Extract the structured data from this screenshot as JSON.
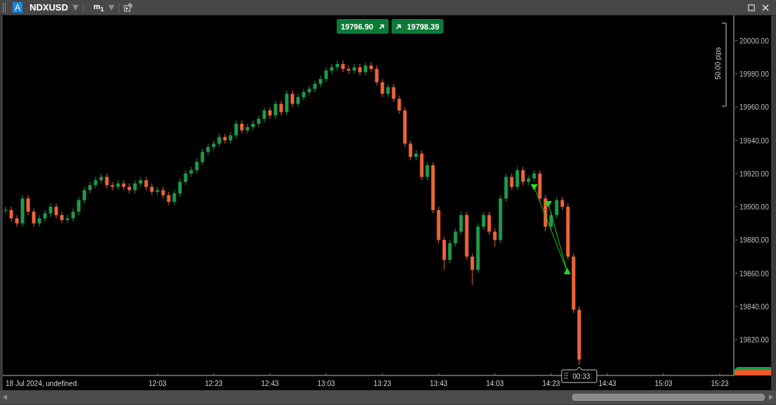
{
  "header": {
    "account_badge": "A",
    "symbol": "NDXUSD",
    "timeframe": "m$_{1}$"
  },
  "quotes": [
    {
      "kind": "sell",
      "price": "19796.90"
    },
    {
      "kind": "buy",
      "price": "19798.39"
    }
  ],
  "chart": {
    "date_label": "18 Jul 2024, undefined",
    "scale_label": "50.00 pips",
    "countdown": "00:33",
    "chart_data": {
      "type": "candlestick",
      "ylim": [
        19798.4,
        20015.2
      ],
      "yticks": [
        {
          "value": 20000,
          "label": "20000.00"
        },
        {
          "value": 19980,
          "label": "19980.00"
        },
        {
          "value": 19960,
          "label": "19960.00"
        },
        {
          "value": 19940,
          "label": "19940.00"
        },
        {
          "value": 19920,
          "label": "19920.00"
        },
        {
          "value": 19900,
          "label": "19900.00"
        },
        {
          "value": 19880,
          "label": "19880.00"
        },
        {
          "value": 19860,
          "label": "19860.00"
        },
        {
          "value": 19840,
          "label": "19840.00"
        },
        {
          "value": 19820,
          "label": "19820.00"
        }
      ],
      "categories": [
        null,
        null,
        null,
        null,
        null,
        null,
        null,
        null,
        null,
        null,
        null,
        null,
        null,
        null,
        null,
        null,
        null,
        null,
        null,
        null,
        null,
        null,
        null,
        null,
        null,
        null,
        null,
        "12:03",
        null,
        null,
        null,
        null,
        null,
        null,
        null,
        null,
        null,
        "12:23",
        null,
        null,
        null,
        null,
        null,
        null,
        null,
        null,
        null,
        "12:43",
        null,
        null,
        null,
        null,
        null,
        null,
        null,
        null,
        null,
        "13:03",
        null,
        null,
        null,
        null,
        null,
        null,
        null,
        null,
        null,
        "13:23",
        null,
        null,
        null,
        null,
        null,
        null,
        null,
        null,
        null,
        "13:43",
        null,
        null,
        null,
        null,
        null,
        null,
        null,
        null,
        null,
        "14:03",
        null,
        null,
        null,
        null,
        null,
        null,
        null,
        null,
        null,
        "14:23",
        null,
        null,
        null,
        null,
        null,
        null,
        null,
        null,
        null,
        "14:43",
        null,
        null,
        null,
        null,
        null,
        null,
        null,
        null,
        null,
        "15:03",
        null,
        null,
        null,
        null,
        null,
        null,
        null,
        null,
        null,
        "15:23",
        null,
        null
      ],
      "ohlc": [
        [
          19898,
          19900,
          19896,
          19898
        ],
        [
          19898,
          19900,
          19891,
          19893
        ],
        [
          19893,
          19895,
          19888,
          19890
        ],
        [
          19890,
          19907,
          19888,
          19905
        ],
        [
          19905,
          19907,
          19895,
          19897
        ],
        [
          19897,
          19899,
          19888,
          19890
        ],
        [
          19890,
          19895,
          19888,
          19893
        ],
        [
          19893,
          19898,
          19891,
          19896
        ],
        [
          19896,
          19902,
          19894,
          19900
        ],
        [
          19900,
          19902,
          19893,
          19895
        ],
        [
          19895,
          19897,
          19890,
          19892
        ],
        [
          19892,
          19895,
          19890,
          19893
        ],
        [
          19893,
          19899,
          19891,
          19897
        ],
        [
          19897,
          19906,
          19895,
          19904
        ],
        [
          19904,
          19912,
          19902,
          19910
        ],
        [
          19910,
          19915,
          19908,
          19913
        ],
        [
          19913,
          19918,
          19911,
          19916
        ],
        [
          19916,
          19920,
          19914,
          19918
        ],
        [
          19918,
          19920,
          19911,
          19913
        ],
        [
          19913,
          19915,
          19910,
          19912
        ],
        [
          19912,
          19916,
          19910,
          19914
        ],
        [
          19914,
          19916,
          19910,
          19912
        ],
        [
          19912,
          19914,
          19908,
          19910
        ],
        [
          19910,
          19916,
          19908,
          19914
        ],
        [
          19914,
          19918,
          19912,
          19916
        ],
        [
          19916,
          19918,
          19910,
          19912
        ],
        [
          19912,
          19914,
          19907,
          19909
        ],
        [
          19909,
          19912,
          19907,
          19910
        ],
        [
          19910,
          19912,
          19905,
          19907
        ],
        [
          19907,
          19909,
          19901,
          19903
        ],
        [
          19903,
          19910,
          19901,
          19908
        ],
        [
          19908,
          19917,
          19906,
          19915
        ],
        [
          19915,
          19922,
          19913,
          19920
        ],
        [
          19920,
          19924,
          19918,
          19922
        ],
        [
          19922,
          19929,
          19920,
          19927
        ],
        [
          19927,
          19935,
          19925,
          19933
        ],
        [
          19933,
          19938,
          19931,
          19936
        ],
        [
          19936,
          19940,
          19934,
          19938
        ],
        [
          19938,
          19944,
          19936,
          19942
        ],
        [
          19942,
          19944,
          19938,
          19940
        ],
        [
          19940,
          19945,
          19938,
          19943
        ],
        [
          19943,
          19952,
          19941,
          19950
        ],
        [
          19950,
          19952,
          19944,
          19946
        ],
        [
          19946,
          19950,
          19944,
          19948
        ],
        [
          19948,
          19952,
          19946,
          19950
        ],
        [
          19950,
          19955,
          19948,
          19953
        ],
        [
          19953,
          19960,
          19951,
          19958
        ],
        [
          19958,
          19960,
          19953,
          19955
        ],
        [
          19955,
          19964,
          19953,
          19962
        ],
        [
          19962,
          19964,
          19955,
          19957
        ],
        [
          19957,
          19970,
          19955,
          19968
        ],
        [
          19968,
          19970,
          19960,
          19962
        ],
        [
          19962,
          19968,
          19960,
          19966
        ],
        [
          19966,
          19971,
          19964,
          19969
        ],
        [
          19969,
          19973,
          19967,
          19971
        ],
        [
          19971,
          19976,
          19969,
          19974
        ],
        [
          19974,
          19979,
          19972,
          19977
        ],
        [
          19977,
          19984,
          19975,
          19982
        ],
        [
          19982,
          19986,
          19980,
          19984
        ],
        [
          19984,
          19988,
          19982,
          19986
        ],
        [
          19986,
          19988,
          19981,
          19983
        ],
        [
          19983,
          19985,
          19980,
          19982
        ],
        [
          19982,
          19986,
          19980,
          19984
        ],
        [
          19984,
          19986,
          19979,
          19981
        ],
        [
          19981,
          19987,
          19979,
          19985
        ],
        [
          19985,
          19987,
          19981,
          19983
        ],
        [
          19983,
          19985,
          19973,
          19975
        ],
        [
          19975,
          19977,
          19966,
          19968
        ],
        [
          19968,
          19974,
          19966,
          19972
        ],
        [
          19972,
          19974,
          19963,
          19965
        ],
        [
          19965,
          19967,
          19956,
          19958
        ],
        [
          19958,
          19960,
          19936,
          19938
        ],
        [
          19938,
          19940,
          19928,
          19930
        ],
        [
          19930,
          19934,
          19928,
          19932
        ],
        [
          19932,
          19934,
          19916,
          19918
        ],
        [
          19918,
          19927,
          19916,
          19925
        ],
        [
          19925,
          19927,
          19896,
          19898
        ],
        [
          19898,
          19900,
          19878,
          19880
        ],
        [
          19880,
          19882,
          19862,
          19868
        ],
        [
          19868,
          19880,
          19866,
          19878
        ],
        [
          19878,
          19887,
          19876,
          19885
        ],
        [
          19885,
          19897,
          19883,
          19895
        ],
        [
          19895,
          19897,
          19868,
          19870
        ],
        [
          19870,
          19872,
          19853,
          19862
        ],
        [
          19862,
          19890,
          19860,
          19888
        ],
        [
          19888,
          19897,
          19886,
          19895
        ],
        [
          19895,
          19897,
          19883,
          19885
        ],
        [
          19885,
          19887,
          19876,
          19880
        ],
        [
          19880,
          19907,
          19878,
          19905
        ],
        [
          19905,
          19920,
          19903,
          19918
        ],
        [
          19918,
          19920,
          19910,
          19912
        ],
        [
          19912,
          19924,
          19910,
          19922
        ],
        [
          19922,
          19924,
          19913,
          19915
        ],
        [
          19915,
          19919,
          19913,
          19917
        ],
        [
          19917,
          19922,
          19915,
          19920
        ],
        [
          19920,
          19922,
          19903,
          19905
        ],
        [
          19905,
          19907,
          19885,
          19888
        ],
        [
          19888,
          19897,
          19886,
          19895
        ],
        [
          19895,
          19906,
          19893,
          19904
        ],
        [
          19904,
          19906,
          19898,
          19900
        ],
        [
          19900,
          19902,
          19868,
          19870
        ],
        [
          19870,
          19872,
          19836,
          19838
        ],
        [
          19838,
          19840,
          19805,
          19808
        ],
        null,
        null,
        null,
        null,
        null,
        null,
        null,
        null,
        null,
        null,
        null,
        null,
        null,
        null,
        null,
        null,
        null,
        null,
        null,
        null,
        null,
        null,
        null,
        null,
        null,
        null,
        null
      ]
    }
  }
}
